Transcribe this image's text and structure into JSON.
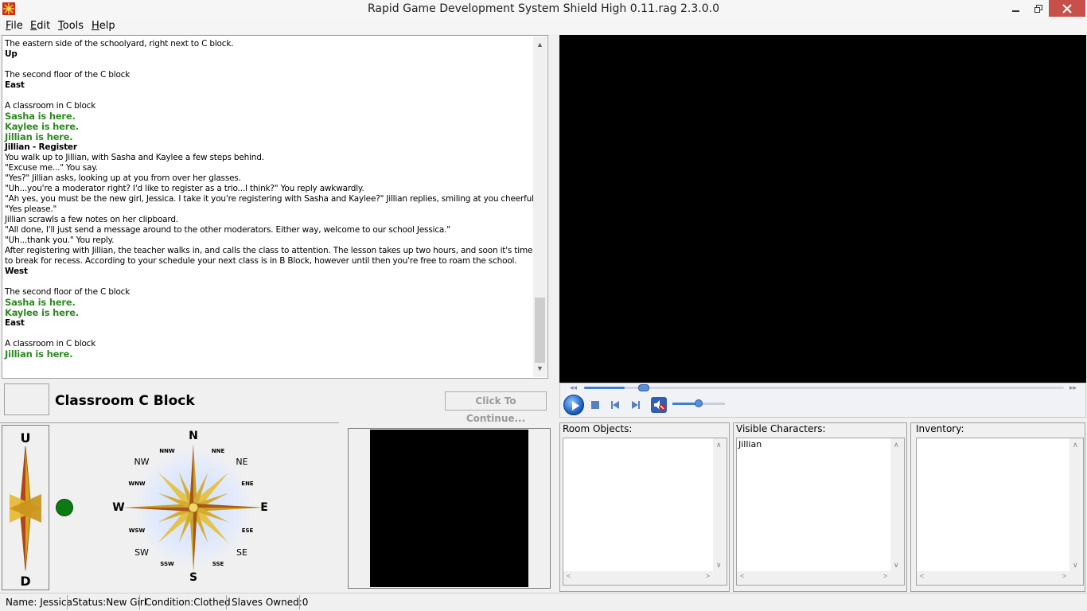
{
  "window": {
    "title": "Rapid Game Development System Shield High 0.11.rag 2.3.0.0",
    "icon": "app-sunburst-icon"
  },
  "menu": {
    "file": "File",
    "edit": "Edit",
    "tools": "Tools",
    "help": "Help"
  },
  "log": {
    "lines": [
      {
        "text": "The eastern side of the schoolyard, right next to C block.",
        "style": "normal"
      },
      {
        "text": "Up",
        "style": "bold"
      },
      {
        "text": "",
        "style": "normal"
      },
      {
        "text": "The second floor of the C block",
        "style": "normal"
      },
      {
        "text": "East",
        "style": "bold"
      },
      {
        "text": "",
        "style": "normal"
      },
      {
        "text": "A classroom in C block",
        "style": "normal"
      },
      {
        "text": "Sasha is here.",
        "style": "green"
      },
      {
        "text": "Kaylee is here.",
        "style": "green"
      },
      {
        "text": "Jillian is here.",
        "style": "green"
      },
      {
        "text": "Jillian - Register",
        "style": "bold"
      },
      {
        "text": "You walk up to Jillian, with Sasha and Kaylee a few steps behind.",
        "style": "normal"
      },
      {
        "text": "\"Excuse me...\" You say.",
        "style": "normal"
      },
      {
        "text": "\"Yes?\" Jillian asks, looking up at you from over her glasses.",
        "style": "normal"
      },
      {
        "text": "\"Uh...you're a moderator right? I'd like to register as a trio...I think?\" You reply awkwardly.",
        "style": "normal"
      },
      {
        "text": "\"Ah yes, you must be the new girl, Jessica. I take it you're registering with Sasha and Kaylee?\" Jillian replies, smiling at you cheerfully.",
        "style": "normal"
      },
      {
        "text": "\"Yes please.\"",
        "style": "normal"
      },
      {
        "text": "Jillian scrawls a few notes on her clipboard.",
        "style": "normal"
      },
      {
        "text": "\"All done, I'll just send a message around to the other moderators. Either way, welcome to our school Jessica.\"",
        "style": "normal"
      },
      {
        "text": "\"Uh...thank you.\" You reply.",
        "style": "normal"
      },
      {
        "text": "After registering with Jillian, the teacher walks in, and calls the class to attention. The lesson takes up two hours, and soon it's time to break for recess. According to your schedule your next class is in B Block, however until then you're free to roam the school.",
        "style": "wrap"
      },
      {
        "text": "West",
        "style": "bold"
      },
      {
        "text": "",
        "style": "normal"
      },
      {
        "text": "The second floor of the C block",
        "style": "normal"
      },
      {
        "text": "Sasha is here.",
        "style": "green"
      },
      {
        "text": "Kaylee is here.",
        "style": "green"
      },
      {
        "text": "East",
        "style": "bold"
      },
      {
        "text": "",
        "style": "normal"
      },
      {
        "text": "A classroom in C block",
        "style": "normal"
      },
      {
        "text": "Jillian is here.",
        "style": "green"
      }
    ]
  },
  "location": {
    "title": "Classroom C Block",
    "continue_label": "Click To Continue..."
  },
  "player": {
    "seek_progress": 0.085,
    "volume_level": 0.5,
    "play_icon": "play-icon",
    "stop_icon": "stop-icon",
    "prev_icon": "previous-icon",
    "next_icon": "next-icon",
    "mute_icon": "mute-icon"
  },
  "compass": {
    "up": "U",
    "down": "D",
    "main": {
      "n": "N",
      "e": "E",
      "s": "S",
      "w": "W"
    },
    "mid": {
      "ne": "NE",
      "se": "SE",
      "sw": "SW",
      "nw": "NW"
    },
    "minor": {
      "nne": "NNE",
      "ene": "ENE",
      "ese": "ESE",
      "sse": "SSE",
      "ssw": "SSW",
      "wsw": "WSW",
      "wnw": "WNW",
      "nnw": "NNW"
    },
    "status_color": "#0b7a12"
  },
  "lists": {
    "room_objects": {
      "label": "Room Objects:",
      "items": []
    },
    "visible_characters": {
      "label": "Visible Characters:",
      "items": [
        "Jillian"
      ]
    },
    "inventory": {
      "label": "Inventory:",
      "items": []
    }
  },
  "status": {
    "name": "Name: Jessica",
    "status": "Status:New Girl",
    "condition": "Condition:Clothed",
    "slaves": "Slaves Owned:0"
  }
}
